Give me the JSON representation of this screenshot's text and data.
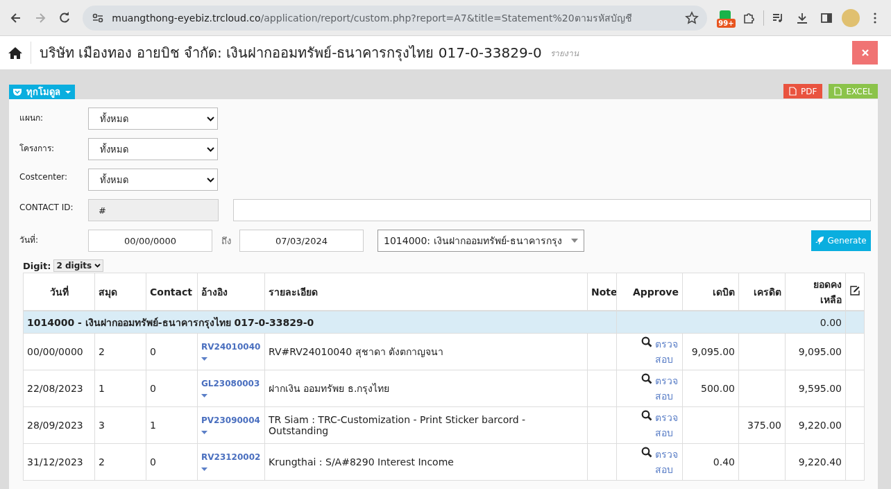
{
  "browser": {
    "url_host": "muangthong-eyebiz.trcloud.co",
    "url_path": "/application/report/custom.php?report=A7&title=Statement%20ตามรหัสบัญชี",
    "badge": "99+"
  },
  "header": {
    "title": "บริษัท เมืองทอง อายบิช จำกัด: เงินฝากออมทรัพย์-ธนาคารกรุงไทย 017-0-33829-0",
    "subtitle": "รายงาน"
  },
  "module_button": "ทุกโมดูล",
  "export_buttons": [
    {
      "label": "PDF",
      "kind": "pdf"
    },
    {
      "label": "EXCEL",
      "kind": "excel"
    }
  ],
  "filters": [
    {
      "label": "แผนก:",
      "value": "ทั้งหมด"
    },
    {
      "label": "โครงการ:",
      "value": "ทั้งหมด"
    },
    {
      "label": "Costcenter:",
      "value": "ทั้งหมด"
    }
  ],
  "contact": {
    "label": "CONTACT ID:",
    "id_value": "#"
  },
  "date": {
    "label": "วันที่:",
    "from": "00/00/0000",
    "to_label": "ถึง",
    "to": "07/03/2024",
    "account": "1014000: เงินฝากออมทรัพย์-ธนาคารกรุง"
  },
  "generate_button": "Generate",
  "digit": {
    "label": "Digit:",
    "value": "2 digits"
  },
  "table": {
    "columns": [
      "วันที่",
      "สมุด",
      "Contact",
      "อ้างอิง",
      "รายละเอียด",
      "Note",
      "Approve",
      "เดบิต",
      "เครดิต",
      "ยอดคงเหลือ"
    ],
    "group": {
      "title": "1014000 - เงินฝากออมทรัพย์-ธนาคารกรุงไทย 017-0-33829-0",
      "balance": "0.00"
    },
    "rows": [
      {
        "date": "00/00/0000",
        "book": "2",
        "contact": "0",
        "ref": "RV24010040",
        "detail": "RV#RV24010040 สุชาดา ตังตกาญจนา",
        "approve": "ตรวจสอบ",
        "debit": "9,095.00",
        "balance": "9,095.00"
      },
      {
        "date": "22/08/2023",
        "book": "1",
        "contact": "0",
        "ref": "GL23080003",
        "detail": "ฝากเงิน ออมทรัพย ธ.กรุงไทย",
        "approve": "ตรวจสอบ",
        "debit": "500.00",
        "balance": "9,595.00"
      },
      {
        "date": "28/09/2023",
        "book": "3",
        "contact": "1",
        "ref": "PV23090004",
        "detail": "TR Siam : TRC-Customization - Print Sticker barcord - Outstanding",
        "approve": "ตรวจสอบ",
        "credit": "375.00",
        "balance": "9,220.00"
      },
      {
        "date": "31/12/2023",
        "book": "2",
        "contact": "0",
        "ref": "RV23120002",
        "detail": "Krungthai : S/A#8290 Interest Income",
        "approve": "ตรวจสอบ",
        "debit": "0.40",
        "balance": "9,220.40"
      }
    ]
  }
}
